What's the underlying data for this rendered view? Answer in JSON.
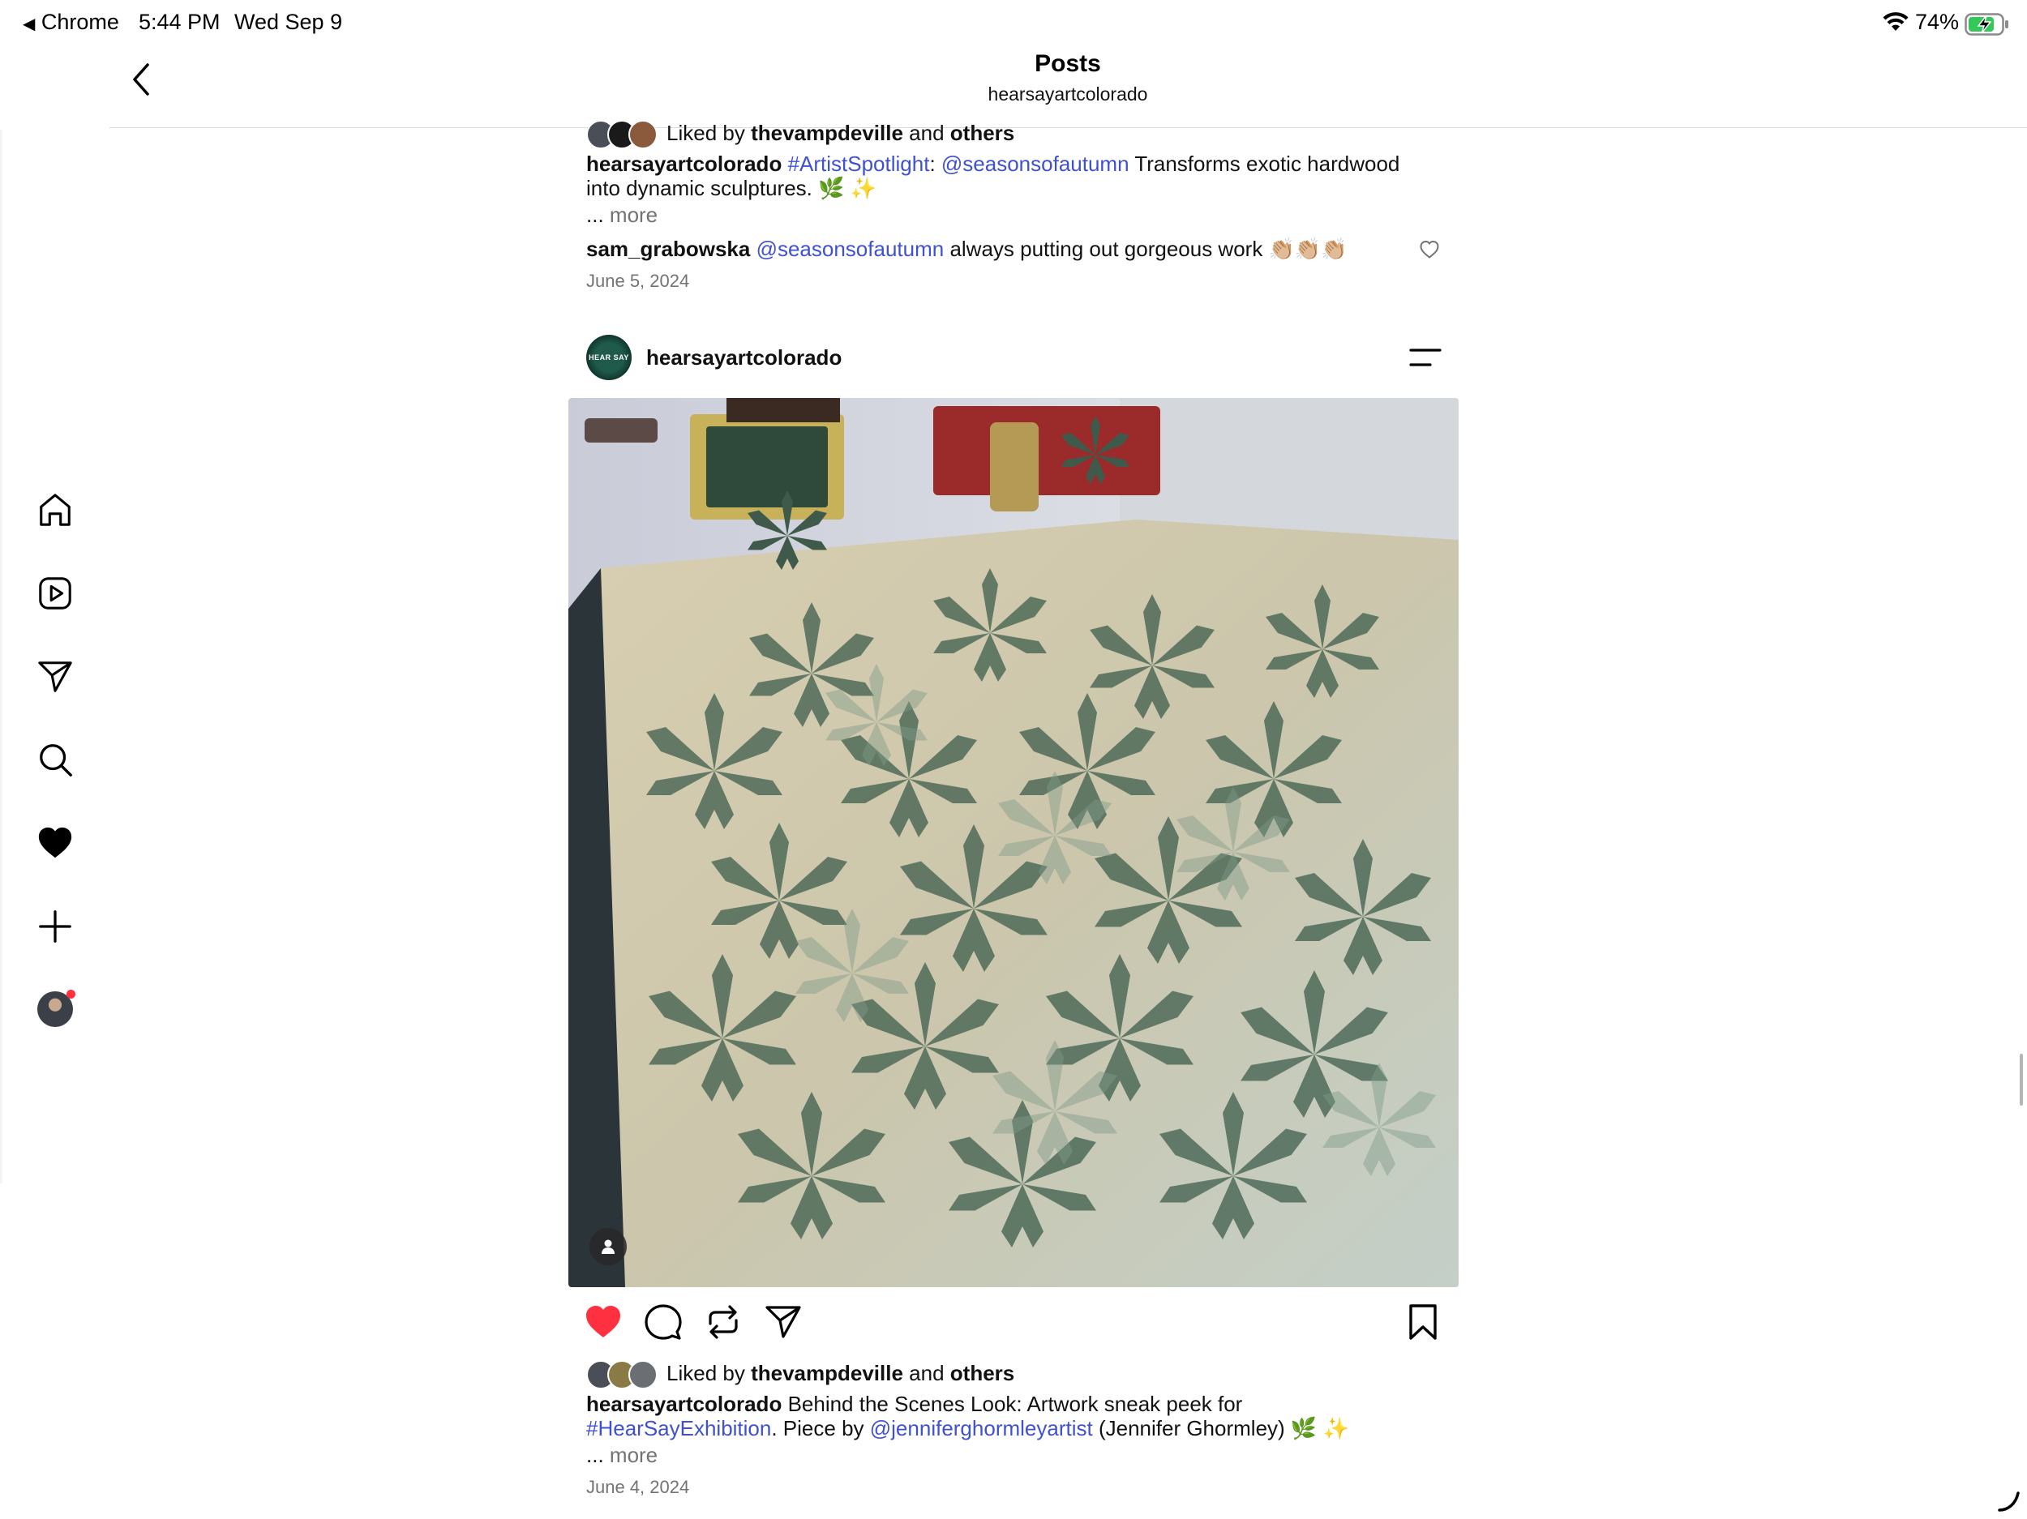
{
  "status_bar": {
    "back_app": "Chrome",
    "time": "5:44 PM",
    "date": "Wed Sep 9",
    "battery": "74%"
  },
  "header": {
    "title": "Posts",
    "subtitle": "hearsayartcolorado"
  },
  "sidebar": {
    "items": [
      {
        "name": "home",
        "icon": "home-icon"
      },
      {
        "name": "reels",
        "icon": "reels-icon"
      },
      {
        "name": "messages",
        "icon": "send-icon"
      },
      {
        "name": "search",
        "icon": "search-icon"
      },
      {
        "name": "activity",
        "icon": "heart-icon"
      },
      {
        "name": "create",
        "icon": "plus-icon"
      },
      {
        "name": "profile",
        "icon": "avatar"
      }
    ]
  },
  "post_previous": {
    "liked_by_prefix": "Liked by",
    "liked_by_user": "thevampdeville",
    "liked_by_and": "and",
    "liked_by_others": "others",
    "caption_user": "hearsayartcolorado",
    "caption_hashtag": "#ArtistSpotlight",
    "caption_colon": ":",
    "caption_mention": "@seasonsofautumn",
    "caption_text_1": "Transforms exotic hardwood",
    "caption_text_2": "into dynamic sculptures. 🌿 ✨",
    "more_prefix": "...",
    "more": "more",
    "comment_user": "sam_grabowska",
    "comment_mention": "@seasonsofautumn",
    "comment_text": "always putting out gorgeous work 👏🏼👏🏼👏🏼",
    "date": "June 5, 2024"
  },
  "post_current": {
    "username": "hearsayartcolorado",
    "avatar_text": "HEAR SAY",
    "liked_by_prefix": "Liked by",
    "liked_by_user": "thevampdeville",
    "liked_by_and": "and",
    "liked_by_others": "others",
    "caption_user": "hearsayartcolorado",
    "caption_text_1": "Behind the Scenes Look: Artwork sneak peek for",
    "caption_hashtag": "#HearSayExhibition",
    "caption_text_2": ". Piece by",
    "caption_mention": "@jenniferghormleyartist",
    "caption_text_3": "(Jennifer Ghormley) 🌿 ✨",
    "more_prefix": "...",
    "more": "more",
    "date": "June 4, 2024",
    "liked": true
  },
  "colors": {
    "link": "#3f51d1",
    "like_red": "#ff3040",
    "text": "#111111",
    "muted": "#737373"
  }
}
